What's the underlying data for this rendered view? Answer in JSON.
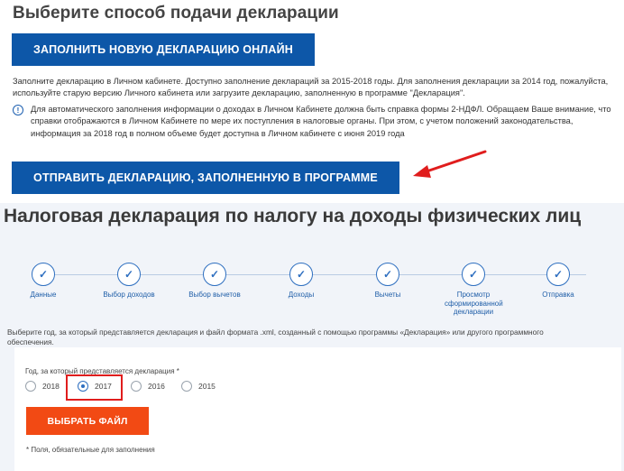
{
  "top_section": {
    "heading": "Выберите способ подачи декларации",
    "online_button_label": "ЗАПОЛНИТЬ НОВУЮ ДЕКЛАРАЦИЮ ОНЛАЙН",
    "info_text": "Заполните декларацию в Личном кабинете. Доступно заполнение деклараций за 2015-2018 годы. Для заполнения декларации за 2014 год, пожалуйста, используйте старую версию Личного кабинета или загрузите декларацию, заполненную в программе \"Декларация\".",
    "notice_text": "Для автоматического заполнения информации о доходах в Личном Кабинете должна быть справка формы 2-НДФЛ. Обращаем Ваше внимание, что справки отображаются в Личном Кабинете по мере их поступления в налоговые органы. При этом, с учетом положений законодательства, информация за 2018 год в полном объеме будет доступна в Личном кабинете с июня 2019 года",
    "program_button_label": "ОТПРАВИТЬ ДЕКЛАРАЦИЮ, ЗАПОЛНЕННУЮ В ПРОГРАММЕ",
    "arrow_color": "#e01d1d"
  },
  "bottom_section": {
    "heading": "Налоговая декларация по налогу на доходы физических лиц",
    "steps": [
      {
        "label": "Данные",
        "icon": "checkmark-icon"
      },
      {
        "label": "Выбор доходов",
        "icon": "checkmark-icon"
      },
      {
        "label": "Выбор вычетов",
        "icon": "checkmark-icon"
      },
      {
        "label": "Доходы",
        "icon": "checkmark-icon"
      },
      {
        "label": "Вычеты",
        "icon": "checkmark-icon"
      },
      {
        "label": "Просмотр сформированной декларации",
        "icon": "checkmark-icon"
      },
      {
        "label": "Отправка",
        "icon": "checkmark-icon"
      }
    ],
    "select_text": "Выберите год, за который представляется декларация и файл формата .xml, созданный с помощью программы «Декларация» или другого программного обеспечения.",
    "form": {
      "year_label": "Год, за который представляется декларация *",
      "years": [
        "2018",
        "2017",
        "2016",
        "2015"
      ],
      "selected_year": "2017",
      "choose_file_label": "ВЫБРАТЬ ФАЙЛ",
      "required_note": "* Поля, обязательные для заполнения"
    }
  },
  "colors": {
    "primary_blue": "#0d57a8",
    "accent_orange": "#f24a14",
    "highlight_red": "#e01d1d",
    "step_blue": "#2e6fc0"
  }
}
